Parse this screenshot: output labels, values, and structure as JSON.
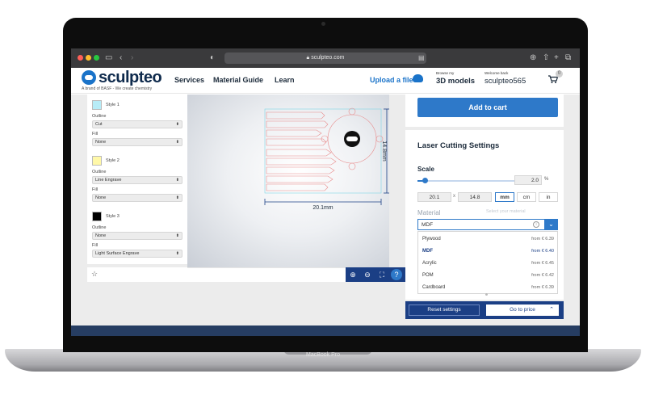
{
  "device": {
    "label": "MacBook Pro"
  },
  "browser": {
    "url": "sculpteo.com"
  },
  "site": {
    "logo": "sculpteo",
    "tagline": "A brand of BASF - We create chemistry",
    "nav": [
      "Services",
      "Material Guide",
      "Learn"
    ],
    "upload": "Upload a file",
    "browse_small": "Browse my",
    "browse_big": "3D models",
    "welcome_small": "Welcome back",
    "user": "sculpteo565",
    "cart_count": "0"
  },
  "styles_panel": {
    "styles": [
      {
        "name": "Style 1",
        "swatch": "#b7ecf7",
        "outline_label": "Outline",
        "outline": "Cut",
        "fill_label": "Fill",
        "fill": "None"
      },
      {
        "name": "Style 2",
        "swatch": "#fff8a8",
        "outline_label": "Outline",
        "outline": "Line Engrave",
        "fill_label": "Fill",
        "fill": "None"
      },
      {
        "name": "Style 3",
        "swatch": "#000000",
        "outline_label": "Outline",
        "outline": "None",
        "fill_label": "Fill",
        "fill": "Light Surface Engrave"
      }
    ]
  },
  "canvas": {
    "width_label": "20.1mm",
    "height_label": "14.8mm"
  },
  "order": {
    "add_to_cart": "Add to cart"
  },
  "laser_settings": {
    "title": "Laser Cutting Settings",
    "scale_label": "Scale",
    "scale_value": "2.0",
    "scale_unit": "%",
    "scale_fraction": 0.08,
    "width": "20.1",
    "times": "x",
    "height": "14.8",
    "units": [
      "mm",
      "cm",
      "in"
    ],
    "active_unit": "mm",
    "material_label": "Material",
    "material_hint": "Select your material",
    "material_value": "MDF",
    "materials": [
      {
        "name": "Plywood",
        "price": "from € 6.39"
      },
      {
        "name": "MDF",
        "price": "from € 6.40",
        "selected": true
      },
      {
        "name": "Acrylic",
        "price": "from € 6.45"
      },
      {
        "name": "POM",
        "price": "from € 6.42"
      },
      {
        "name": "Cardboard",
        "price": "from € 6.39"
      }
    ],
    "reset": "Reset settings",
    "go_to_price": "Go to price"
  }
}
